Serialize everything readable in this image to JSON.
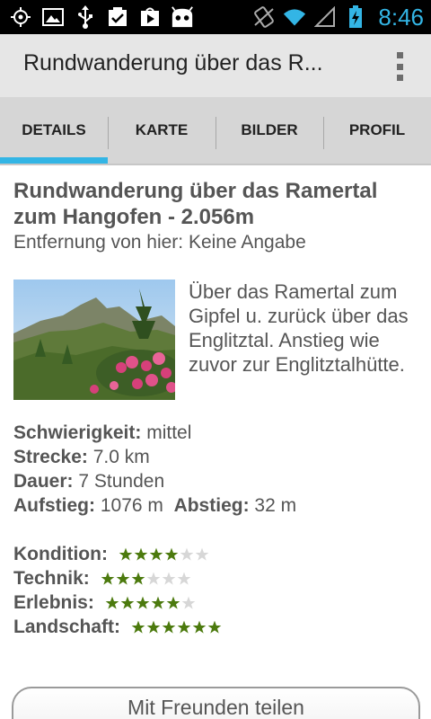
{
  "status_bar": {
    "time": "8:46",
    "left_icons": [
      "gps-icon",
      "image-icon",
      "usb-icon",
      "task-check-icon",
      "play-store-icon",
      "android-icon"
    ],
    "right_icons": [
      "vibrate-icon",
      "wifi-icon",
      "signal-icon",
      "battery-charging-icon"
    ]
  },
  "action_bar": {
    "title": "Rundwanderung über das R..."
  },
  "tabs": [
    {
      "label": "DETAILS",
      "active": true
    },
    {
      "label": "KARTE",
      "active": false
    },
    {
      "label": "BILDER",
      "active": false
    },
    {
      "label": "PROFIL",
      "active": false
    }
  ],
  "route": {
    "title": "Rundwanderung über das Ramertal zum Hangofen - 2.056m",
    "distance": "Entfernung von hier: Keine Angabe",
    "description": "Über das Ramertal zum Gipfel u. zurück über das Englitztal. Anstieg wie zuvor zur Englitztalhütte."
  },
  "facts": {
    "difficulty_label": "Schwierigkeit:",
    "difficulty_value": " mittel",
    "distance_label": "Strecke:",
    "distance_value": " 7.0 km",
    "duration_label": "Dauer:",
    "duration_value": " 7 Stunden",
    "ascent_label": "Aufstieg:",
    "ascent_value": " 1076 m",
    "descent_label": "Abstieg:",
    "descent_value": " 32 m"
  },
  "ratings": [
    {
      "label": "Kondition:",
      "filled": 4,
      "total": 6
    },
    {
      "label": "Technik:",
      "filled": 3,
      "total": 6
    },
    {
      "label": "Erlebnis:",
      "filled": 5,
      "total": 6
    },
    {
      "label": "Landschaft:",
      "filled": 6,
      "total": 6
    }
  ],
  "colors": {
    "accent": "#33b5e5",
    "star_filled": "#4c7a0e",
    "star_empty": "#d7d7d7"
  },
  "share_button": {
    "label": "Mit Freunden teilen"
  }
}
